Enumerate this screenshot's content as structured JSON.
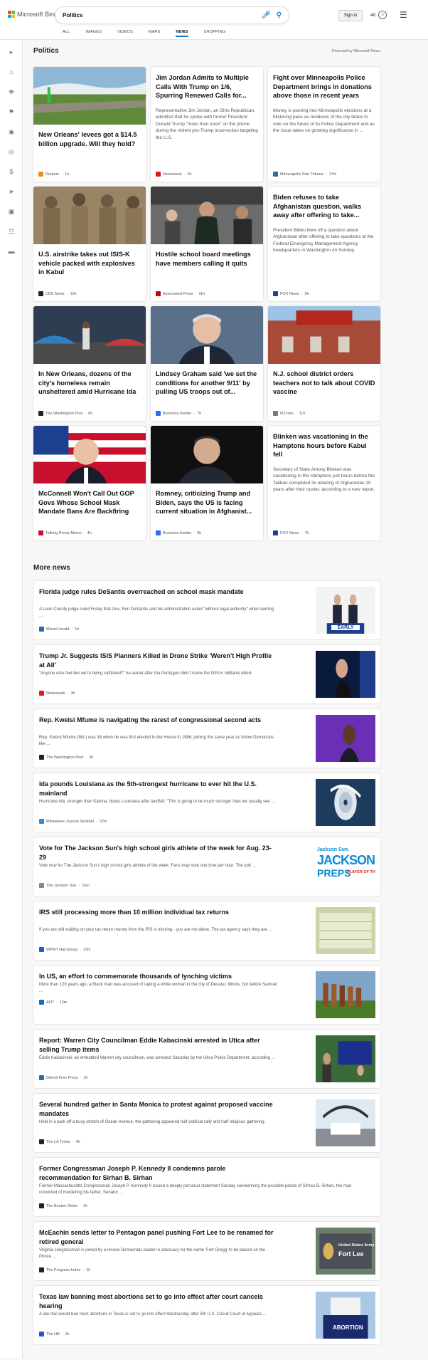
{
  "header": {
    "logo_text": "Microsoft Bing",
    "query": "Politics",
    "signin_label": "Sign in",
    "rewards_points": "40",
    "tabs": [
      "ALL",
      "IMAGES",
      "VIDEOS",
      "MAPS",
      "NEWS",
      "SHOPPING"
    ],
    "active_tab": "NEWS"
  },
  "colors": {
    "accent": "#0b7fd6"
  },
  "section": {
    "title": "Politics",
    "powered_by": "Powered by Microsoft News"
  },
  "cards": [
    {
      "title": "New Orleans' levees got a $14.5 billion upgrade. Will they hold?",
      "desc": "",
      "source": "Reuters",
      "time": "1h",
      "src_color": "#f08a24",
      "img": "levee"
    },
    {
      "title": "Jim Jordan Admits to Multiple Calls With Trump on 1/6, Spurring Renewed Calls for...",
      "desc": "Representative Jim Jordan, an Ohio Republican, admitted that he spoke with former President Donald Trump \"more than once\" on the phone during the violent pro-Trump insurrection targeting the U.S.",
      "source": "Newsweek",
      "time": "5h",
      "src_color": "#e3171b",
      "img": ""
    },
    {
      "title": "Fight over Minneapolis Police Department brings in donations above those in recent years",
      "desc": "Money is pouring into Minneapolis elections at a blistering pace as residents of the city brace to vote on the future of its Police Department and as the issue takes on growing significance in ...",
      "source": "Minneapolis Star Tribune",
      "time": "17m",
      "src_color": "#2b6cb0",
      "img": ""
    },
    {
      "title": "U.S. airstrike takes out ISIS-K vehicle packed with explosives in Kabul",
      "desc": "",
      "source": "CBS News",
      "time": "10h",
      "src_color": "#222",
      "img": "soldiers"
    },
    {
      "title": "Hostile school board meetings have members calling it quits",
      "desc": "",
      "source": "Associated Press",
      "time": "11h",
      "src_color": "#c00",
      "img": "meeting"
    },
    {
      "title": "Biden refuses to take Afghanistan question, walks away after offering to take...",
      "desc": "President Biden blew off a question about Afghanistan after offering to take questions at the Federal Emergency Management Agency headquarters in Washington on Sunday.",
      "source": "FOX News",
      "time": "5h",
      "src_color": "#1c3f8f",
      "img": ""
    },
    {
      "title": "In New Orleans, dozens of the city's homeless remain unsheltered amid Hurricane Ida",
      "desc": "",
      "source": "The Washington Post",
      "time": "6h",
      "src_color": "#222",
      "img": "homeless"
    },
    {
      "title": "Lindsey Graham said 'we set the conditions for another 9/11' by pulling US troops out of...",
      "desc": "",
      "source": "Business Insider",
      "time": "7h",
      "src_color": "#2b6cf0",
      "img": "graham"
    },
    {
      "title": "N.J. school district orders teachers not to talk about COVID vaccine",
      "desc": "",
      "source": "NJ.com",
      "time": "11h",
      "src_color": "#777",
      "img": "school"
    },
    {
      "title": "McConnell Won't Call Out GOP Govs Whose School Mask Mandate Bans Are Backfiring",
      "desc": "",
      "source": "Talking Points Memo",
      "time": "4h",
      "src_color": "#c8102e",
      "img": "mcconnell"
    },
    {
      "title": "Romney, criticizing Trump and Biden, says the US is facing current situation in Afghanist...",
      "desc": "",
      "source": "Business Insider",
      "time": "9h",
      "src_color": "#2b6cf0",
      "img": "romney"
    },
    {
      "title": "Blinken was vacationing in the Hamptons hours before Kabul fell",
      "desc": "Secretary of State Antony Blinken was vacationing in the Hamptons just hours before the Taliban completed its retaking of Afghanistan 20 years after their ouster, according to a new report.",
      "source": "FOX News",
      "time": "7h",
      "src_color": "#1c3f8f",
      "img": ""
    }
  ],
  "more_news": {
    "title": "More news",
    "items": [
      {
        "title": "Florida judge rules DeSantis overreached on school mask mandate",
        "desc": "A Leon County judge ruled Friday that Gov. Ron DeSantis and his administration acted \"without legal authority\" when barring ...",
        "source": "Miami Herald",
        "time": "1h",
        "src_color": "#2b6cb0",
        "img": "desantis"
      },
      {
        "title": "Trump Jr. Suggests ISIS Planners Killed in Drone Strike 'Weren't High Profile at All'",
        "desc": "\"Anyone else feel like we're being catfished?\" he asked after the Pentagon didn't name the ISIS-K militants killed.",
        "source": "Newsweek",
        "time": "3h",
        "src_color": "#e3171b",
        "img": "trumpjr"
      },
      {
        "title": "Rep. Kweisi Mfume is navigating the rarest of congressional second acts",
        "desc": "Rep. Kweisi Mfume (Md.) was 38 when he was first elected to the House in 1986, joining the same year as fellow Democrats like ...",
        "source": "The Washington Post",
        "time": "3h",
        "src_color": "#222",
        "img": "mfume"
      },
      {
        "title": "Ida pounds Louisiana as the 5th-strongest hurricane to ever hit the U.S. mainland",
        "desc": "Hurricane Ida, stronger than Katrina, blasts Louisiana after landfall: \"This is going to be much stronger than we usually see ...",
        "source": "Milwaukee Journal Sentinel",
        "time": "22m",
        "src_color": "#2b8fd6",
        "img": "hurricane"
      },
      {
        "title": "Vote for The Jackson Sun's high school girls athlete of the week for Aug. 23-29",
        "desc": "Vote now for The Jackson Sun's high school girls athlete of the week. Fans may vote one time per hour. The poll ...",
        "source": "The Jackson Sun",
        "time": "16m",
        "src_color": "#888",
        "img": "jackson"
      },
      {
        "title": "IRS still processing more than 10 million individual tax returns",
        "desc": "If you are still waiting on your tax return money from the IRS is missing - you are not alone. The tax agency says they are ...",
        "source": "WPMT Harrisburg",
        "time": "13m",
        "src_color": "#1f5fbf",
        "img": "irs"
      },
      {
        "title": "In US, an effort to commemorate thousands of lynching victims",
        "desc": "More than 120 years ago, a Black man was accused of raping a white woman in the city of Decatur, Illinois, but before Samuel ...",
        "source": "AFP",
        "time": "13m",
        "src_color": "#1c64c8",
        "img": "memorial"
      },
      {
        "title": "Report: Warren City Councilman Eddie Kabacinski arrested in Utica after selling Trump items",
        "desc": "Eddie Kabacinski, an embattled Warren city councilman, was arrested Saturday by the Utica Police Department, according ...",
        "source": "Detroit Free Press",
        "time": "2h",
        "src_color": "#2b6cb0",
        "img": "rally"
      },
      {
        "title": "Several hundred gather in Santa Monica to protest against proposed vaccine mandates",
        "desc": "Held in a park off a busy stretch of Ocean Avenue, the gathering appeared half political rally and half religious gathering.",
        "source": "The LA Times",
        "time": "4h",
        "src_color": "#222",
        "img": "santamonica"
      },
      {
        "title": "Former Congressman Joseph P. Kennedy II condemns parole recommendation for Sirhan B. Sirhan",
        "desc": "Former Massachusetts Congressman Joseph P. Kennedy II issued a deeply personal statement Sunday condemning the possible parole of Sirhan B. Sirhan, the man convicted of murdering his father, Senator ...",
        "source": "The Boston Globe",
        "time": "2h",
        "src_color": "#222",
        "img": ""
      },
      {
        "title": "McEachin sends letter to Pentagon panel pushing Fort Lee to be renamed for retired general",
        "desc": "Virginia congressman is joined by a House Democratic leader in advocacy for the name 'Fort Gregg' to be placed on the Prince ...",
        "source": "The Progress-Index",
        "time": "1h",
        "src_color": "#222",
        "img": "fortlee"
      },
      {
        "title": "Texas law banning most abortions set to go into effect after court cancels hearing",
        "desc": "A law that would ban most abortions in Texas is set to go into effect Wednesday after 5th U.S. Circuit Court of Appeals ...",
        "source": "The Hill",
        "time": "1h",
        "src_color": "#2b55c8",
        "img": "abortion"
      }
    ]
  },
  "thumb_text": {
    "early": "EARLY",
    "jackson_sun": "Jackson Sun.",
    "jackson_big": "JACKSON",
    "jackson_preps": "PREPS",
    "jackson_sub": "PLAYER OF THE WEEK",
    "army": "United States Army",
    "fort_lee": "Fort Lee",
    "abortion": "ABORTION"
  }
}
